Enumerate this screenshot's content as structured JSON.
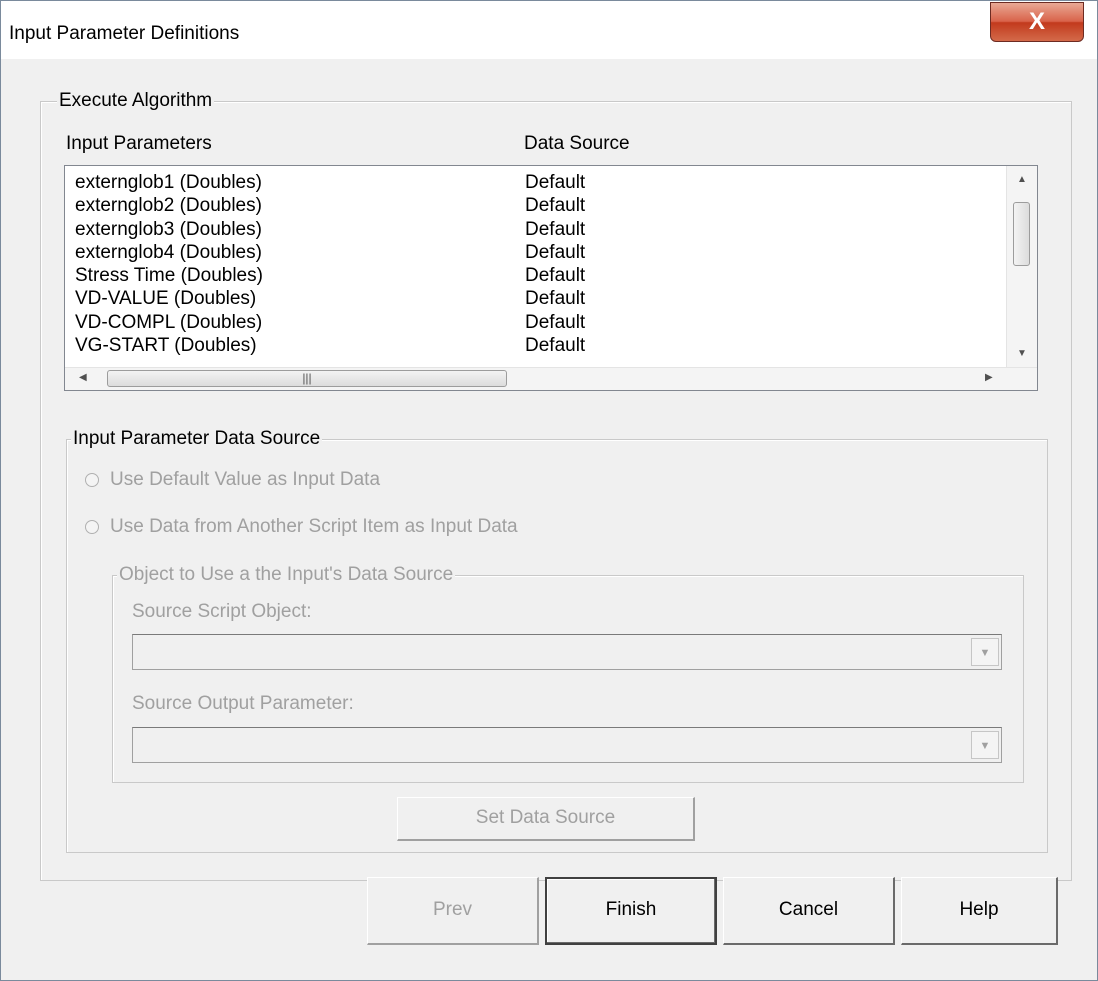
{
  "window": {
    "title": "Input Parameter Definitions",
    "close_glyph": "X"
  },
  "execute_group": {
    "legend": "Execute Algorithm",
    "col_params": "Input Parameters",
    "col_source": "Data Source",
    "rows": [
      {
        "param": "externglob1  (Doubles)",
        "source": "Default"
      },
      {
        "param": "externglob2  (Doubles)",
        "source": "Default"
      },
      {
        "param": "externglob3  (Doubles)",
        "source": "Default"
      },
      {
        "param": "externglob4  (Doubles)",
        "source": "Default"
      },
      {
        "param": "Stress Time  (Doubles)",
        "source": "Default"
      },
      {
        "param": "VD-VALUE  (Doubles)",
        "source": "Default"
      },
      {
        "param": "VD-COMPL  (Doubles)",
        "source": "Default"
      },
      {
        "param": "VG-START  (Doubles)",
        "source": "Default"
      }
    ]
  },
  "data_source_group": {
    "legend": "Input Parameter Data Source",
    "radio_default": "Use Default Value as Input Data",
    "radio_script": "Use Data from Another Script Item as Input Data",
    "object_group": {
      "legend": "Object to Use a the Input's Data Source",
      "source_object_label": "Source Script Object:",
      "source_object_value": "",
      "source_output_label": "Source Output Parameter:",
      "source_output_value": ""
    },
    "set_button": "Set Data Source"
  },
  "footer": {
    "prev": "Prev",
    "finish": "Finish",
    "cancel": "Cancel",
    "help": "Help"
  },
  "colors": {
    "disabled_text": "#a0a0a0",
    "close_red": "#c7442a",
    "dialog_bg": "#f0f0f0"
  }
}
